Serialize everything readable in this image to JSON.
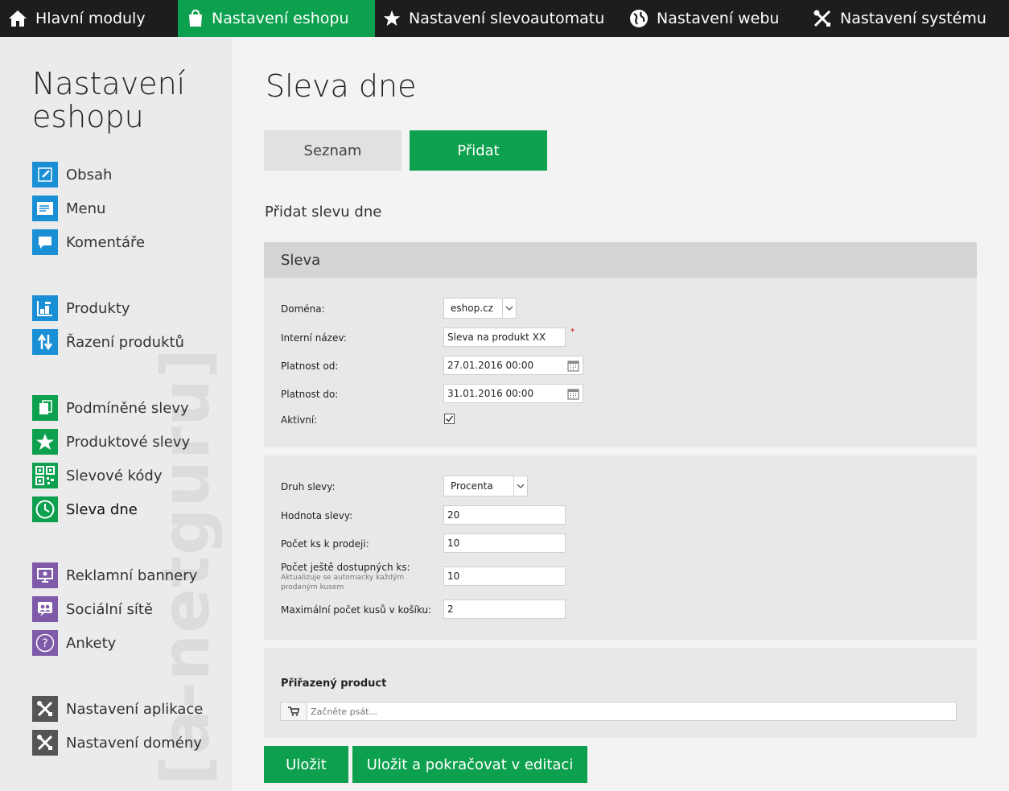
{
  "topnav": {
    "items": [
      {
        "label": "Hlavní moduly",
        "icon": "home-icon"
      },
      {
        "label": "Nastavení eshopu",
        "icon": "shopping-bag-icon",
        "active": true
      },
      {
        "label": "Nastavení slevoautomatu",
        "icon": "star-icon"
      },
      {
        "label": "Nastavení webu",
        "icon": "globe-icon"
      },
      {
        "label": "Nastavení systému",
        "icon": "tools-icon"
      }
    ]
  },
  "sidebar": {
    "title": "Nastavení eshopu",
    "watermark": "[a-netguru]",
    "items": [
      {
        "label": "Obsah",
        "icon": "edit-icon",
        "color": "#1a8fd6"
      },
      {
        "label": "Menu",
        "icon": "menu-icon",
        "color": "#1a8fd6"
      },
      {
        "label": "Komentáře",
        "icon": "comment-icon",
        "color": "#1a8fd6"
      },
      {
        "label": "Produkty",
        "icon": "products-icon",
        "color": "#1a8fd6"
      },
      {
        "label": "Řazení produktů",
        "icon": "sort-icon",
        "color": "#1a8fd6"
      },
      {
        "label": "Podmíněné slevy",
        "icon": "conditional-discount-icon",
        "color": "#0da04e"
      },
      {
        "label": "Produktové slevy",
        "icon": "star-icon",
        "color": "#0da04e"
      },
      {
        "label": "Slevové kódy",
        "icon": "qr-code-icon",
        "color": "#0da04e"
      },
      {
        "label": "Sleva dne",
        "icon": "clock-icon",
        "color": "#0da04e",
        "active": true
      },
      {
        "label": "Reklamní bannery",
        "icon": "banner-icon",
        "color": "#7f5aa8"
      },
      {
        "label": "Sociální sítě",
        "icon": "people-icon",
        "color": "#7f5aa8"
      },
      {
        "label": "Ankety",
        "icon": "question-icon",
        "color": "#7f5aa8"
      },
      {
        "label": "Nastavení aplikace",
        "icon": "tools-icon",
        "color": "#555555"
      },
      {
        "label": "Nastavení domény",
        "icon": "tools-icon",
        "color": "#555555"
      }
    ]
  },
  "main": {
    "title": "Sleva dne",
    "tabs": {
      "list": "Seznam",
      "add": "Přidat"
    },
    "subtitle": "Přidat slevu dne",
    "sleva_panel": {
      "heading": "Sleva",
      "domain_label": "Doména:",
      "domain_value": "eshop.cz",
      "internal_name_label": "Interní název:",
      "internal_name_value": "Sleva na produkt XX",
      "required_mark": "*",
      "valid_from_label": "Platnost od:",
      "valid_from_value": "27.01.2016 00:00",
      "valid_to_label": "Platnost do:",
      "valid_to_value": "31.01.2016 00:00",
      "active_label": "Aktivní:",
      "active_checked": true
    },
    "discount_panel": {
      "type_label": "Druh slevy:",
      "type_value": "Procenta",
      "value_label": "Hodnota slevy:",
      "value_value": "20",
      "count_label": "Počet ks k prodeji:",
      "count_value": "10",
      "available_label": "Počet ještě dostupných ks:",
      "available_note": "Aktualizuje se automacky každým prodaným kusem",
      "available_value": "10",
      "max_label": "Maximální počet kusů v košíku:",
      "max_value": "2"
    },
    "product_panel": {
      "heading": "Přiřazený product",
      "search_placeholder": "Začněte psát..."
    },
    "buttons": {
      "save": "Uložit",
      "save_continue": "Uložit a pokračovat v editaci"
    }
  }
}
